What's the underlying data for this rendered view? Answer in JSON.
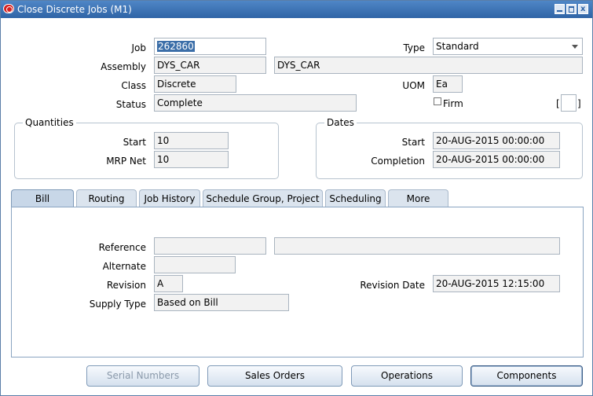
{
  "window": {
    "title": "Close Discrete Jobs (M1)"
  },
  "header": {
    "job_label": "Job",
    "job_value": "262860",
    "type_label": "Type",
    "type_value": "Standard",
    "assembly_label": "Assembly",
    "assembly_value": "DYS_CAR",
    "assembly_desc": "DYS_CAR",
    "class_label": "Class",
    "class_value": "Discrete",
    "uom_label": "UOM",
    "uom_value": "Ea",
    "status_label": "Status",
    "status_value": "Complete",
    "firm_label": "Firm",
    "bracket_left": "[",
    "bracket_right": "]"
  },
  "quantities": {
    "title": "Quantities",
    "start_label": "Start",
    "start_value": "10",
    "mrp_label": "MRP Net",
    "mrp_value": "10"
  },
  "dates": {
    "title": "Dates",
    "start_label": "Start",
    "start_value": "20-AUG-2015 00:00:00",
    "completion_label": "Completion",
    "completion_value": "20-AUG-2015 00:00:00"
  },
  "tabs": [
    "Bill",
    "Routing",
    "Job History",
    "Schedule Group, Project",
    "Scheduling",
    "More"
  ],
  "bill": {
    "reference_label": "Reference",
    "reference_value": "",
    "reference_desc": "",
    "alternate_label": "Alternate",
    "alternate_value": "",
    "revision_label": "Revision",
    "revision_value": "A",
    "revision_date_label": "Revision Date",
    "revision_date_value": "20-AUG-2015 12:15:00",
    "supply_type_label": "Supply Type",
    "supply_type_value": "Based on Bill"
  },
  "buttons": {
    "serial_numbers": "Serial Numbers",
    "sales_orders": "Sales Orders",
    "operations": "Operations",
    "components": "Components"
  }
}
